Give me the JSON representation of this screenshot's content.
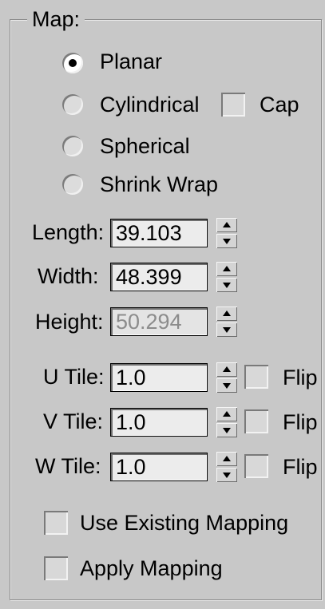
{
  "map_group": {
    "title": "Map:"
  },
  "mapping_types": [
    {
      "label": "Planar",
      "selected": true
    },
    {
      "label": "Cylindrical",
      "selected": false
    },
    {
      "label": "Spherical",
      "selected": false
    },
    {
      "label": "Shrink Wrap",
      "selected": false
    }
  ],
  "cap": {
    "label": "Cap",
    "checked": false
  },
  "dimensions": {
    "length": {
      "label": "Length:",
      "value": "39.103",
      "enabled": true
    },
    "width": {
      "label": "Width:",
      "value": "48.399",
      "enabled": true
    },
    "height": {
      "label": "Height:",
      "value": "50.294",
      "enabled": false
    }
  },
  "tiling": {
    "u": {
      "label": "U Tile:",
      "value": "1.0",
      "flip_label": "Flip",
      "flip_checked": false
    },
    "v": {
      "label": "V Tile:",
      "value": "1.0",
      "flip_label": "Flip",
      "flip_checked": false
    },
    "w": {
      "label": "W Tile:",
      "value": "1.0",
      "flip_label": "Flip",
      "flip_checked": false
    }
  },
  "options": {
    "use_existing_mapping": {
      "label": "Use Existing Mapping",
      "checked": false
    },
    "apply_mapping": {
      "label": "Apply Mapping",
      "checked": false
    }
  },
  "icons": {
    "spinner_up": "triangle-up",
    "spinner_down": "triangle-down"
  }
}
